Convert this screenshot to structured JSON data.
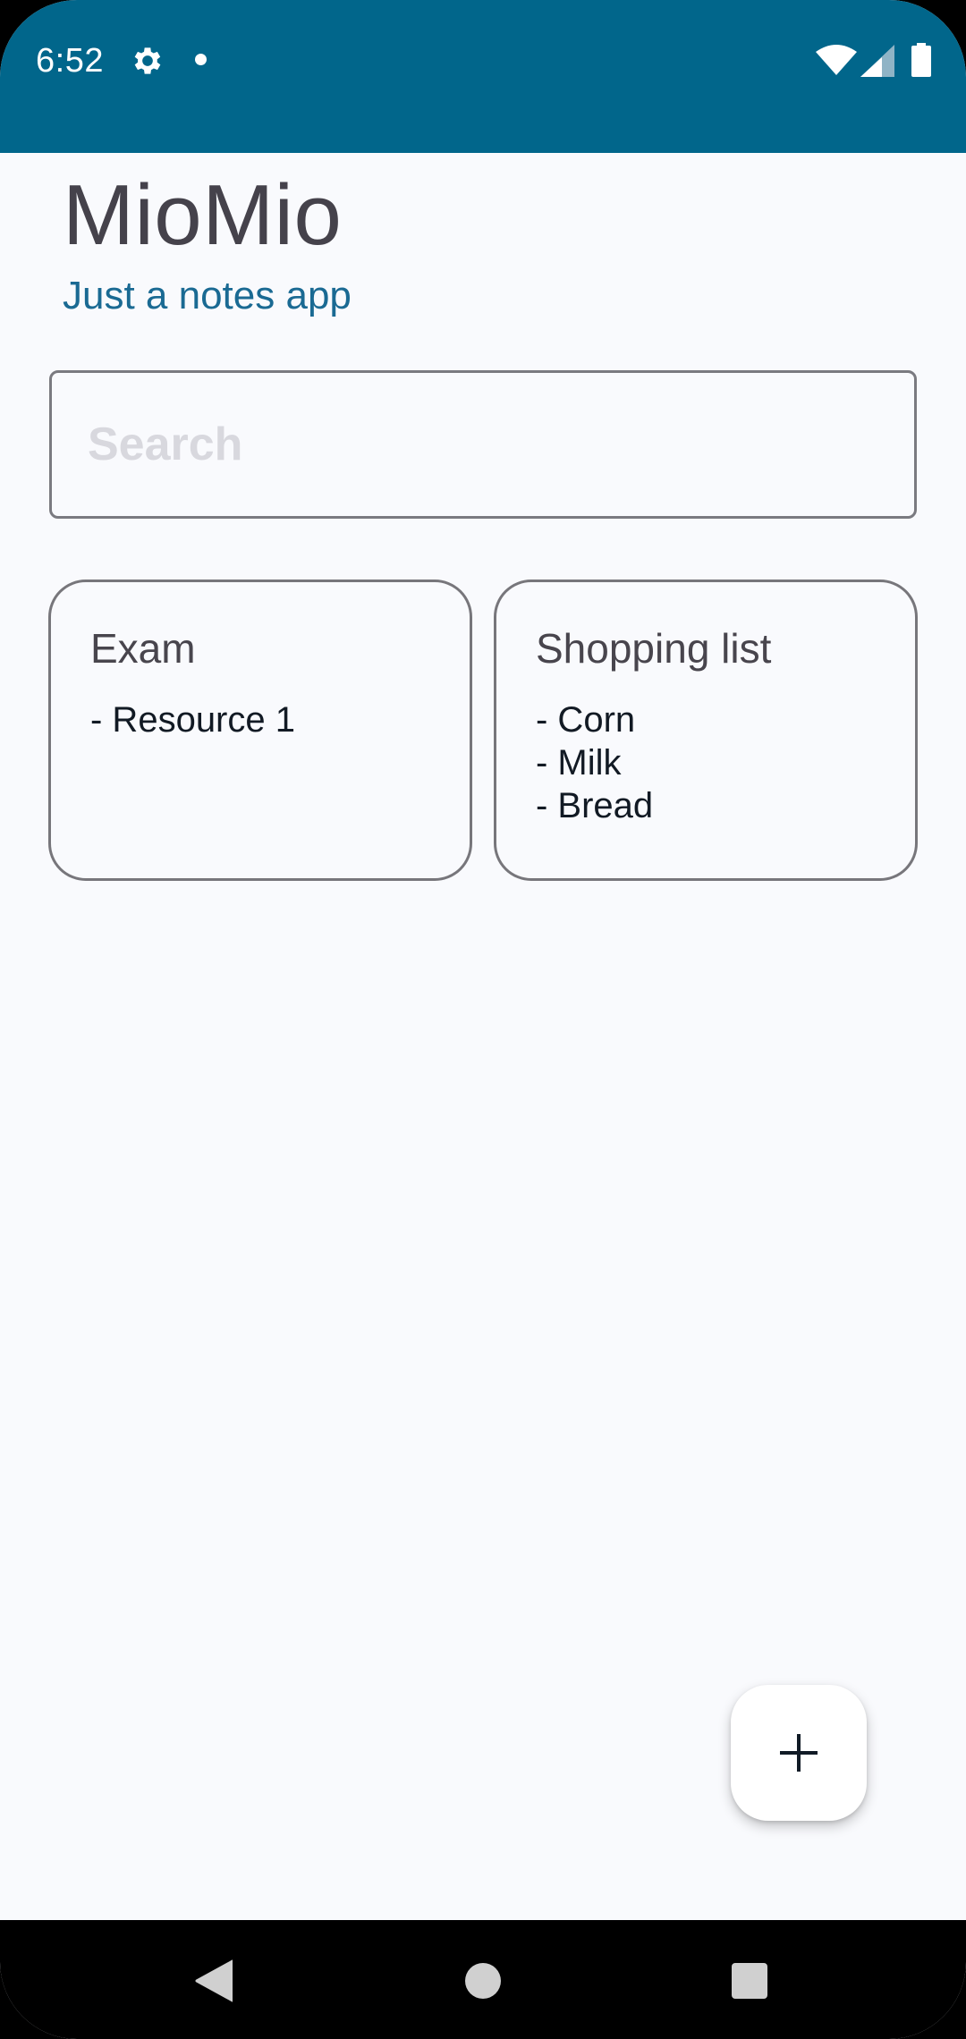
{
  "status_bar": {
    "time": "6:52",
    "background_color": "#01668b",
    "icons": [
      "gear-icon",
      "notification-dot-icon",
      "wifi-icon",
      "cell-signal-icon",
      "battery-icon"
    ]
  },
  "header": {
    "title": "MioMio",
    "subtitle": "Just a notes app"
  },
  "search": {
    "placeholder": "Search",
    "value": ""
  },
  "notes": [
    {
      "title": "Exam",
      "lines": [
        "- Resource 1"
      ]
    },
    {
      "title": "Shopping list",
      "lines": [
        "- Corn",
        "- Milk",
        "- Bread"
      ]
    }
  ],
  "fab": {
    "icon": "plus-icon"
  },
  "nav_bar": {
    "icons": [
      "back-icon",
      "home-icon",
      "recents-icon"
    ]
  },
  "colors": {
    "accent": "#01668b",
    "subtitle": "#1a6a93",
    "background": "#f9fafd"
  }
}
